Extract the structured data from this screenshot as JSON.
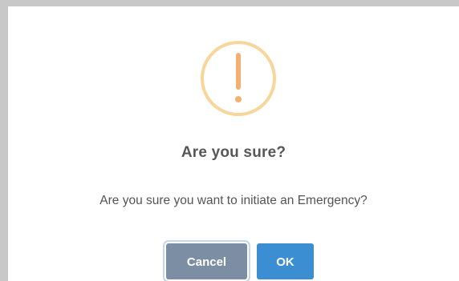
{
  "dialog": {
    "title": "Are you sure?",
    "message": "Are you sure you want to initiate an Emergency?",
    "icon": "warning-exclamation-icon",
    "icon_color": "#f8c486",
    "buttons": {
      "cancel_label": "Cancel",
      "ok_label": "OK"
    },
    "colors": {
      "cancel_button": "#7c8ea4",
      "ok_button": "#3c8ed3"
    }
  }
}
